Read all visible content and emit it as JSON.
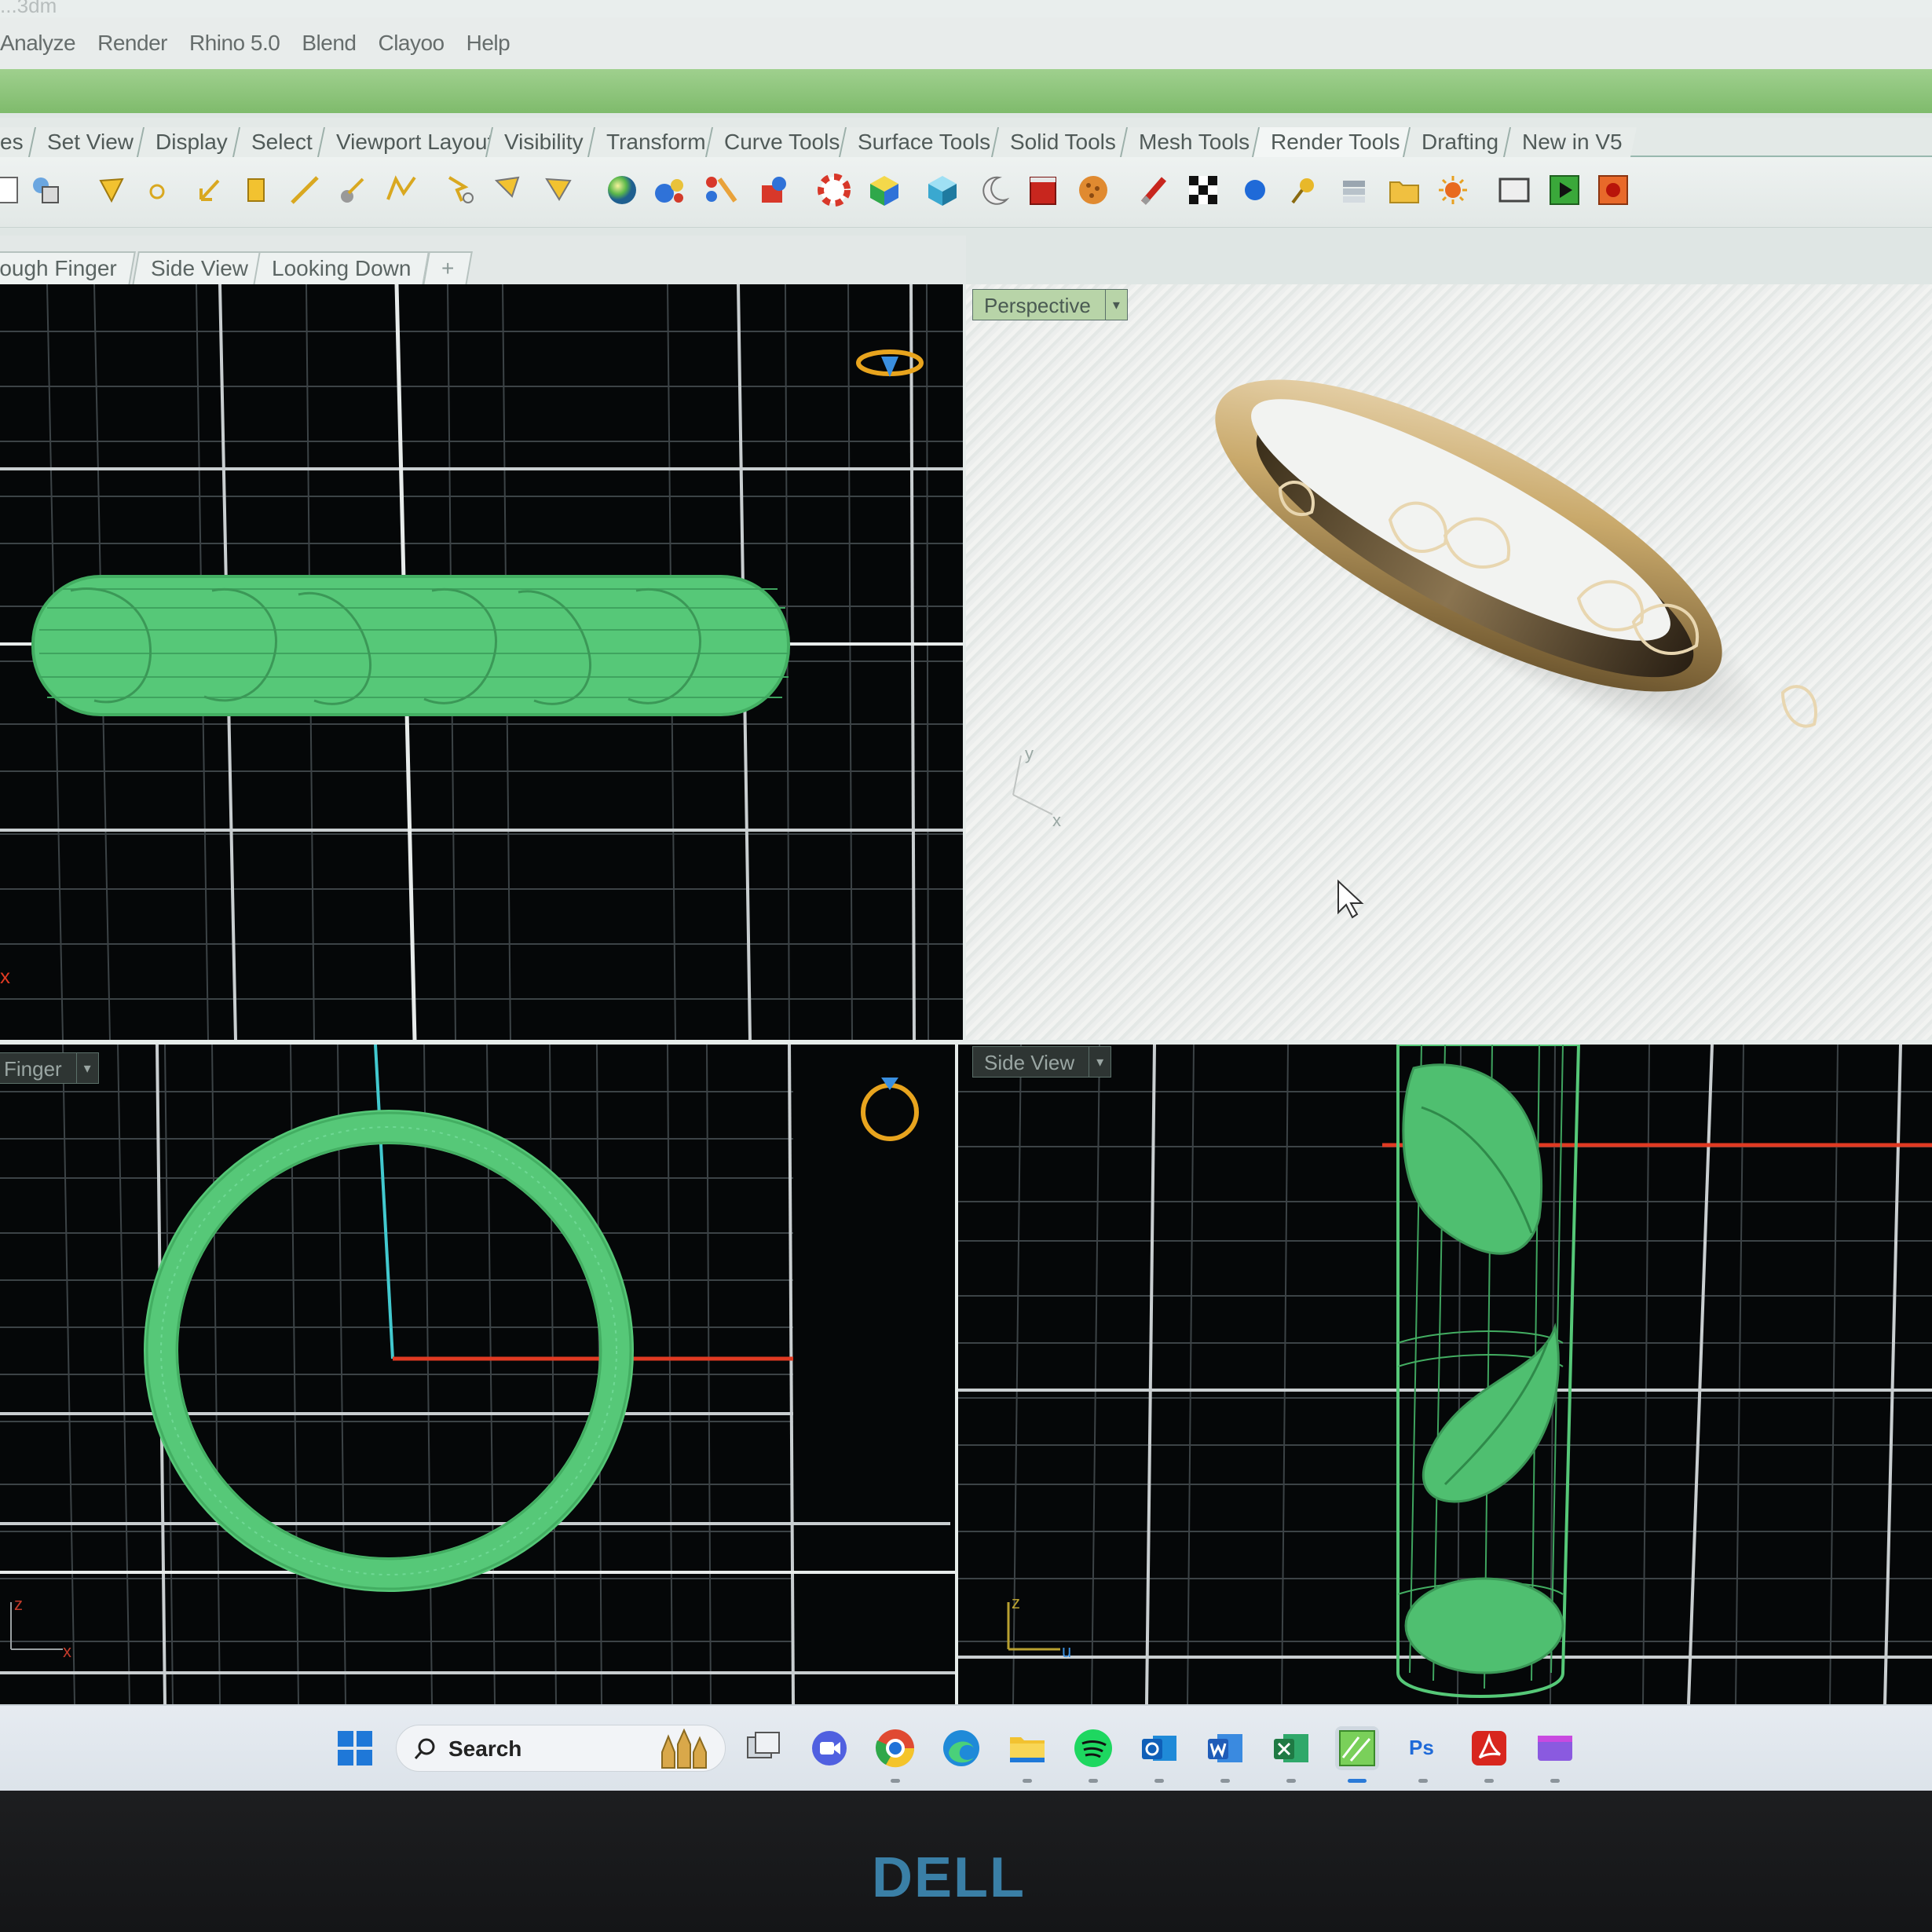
{
  "window": {
    "title_fragment": "...3dm"
  },
  "menubar": {
    "items": [
      "Analyze",
      "Render",
      "Rhino 5.0",
      "Blend",
      "Clayoo",
      "Help"
    ]
  },
  "toolbar_tabs": [
    "es",
    "Set View",
    "Display",
    "Select",
    "Viewport Layout",
    "Visibility",
    "Transform",
    "Curve Tools",
    "Surface Tools",
    "Solid Tools",
    "Mesh Tools",
    "Render Tools",
    "Drafting",
    "New in V5"
  ],
  "toolbar_active_tab": "Render Tools",
  "toolbar_icons": [
    "new-file-icon",
    "save-icon",
    "point-icon",
    "circle-icon",
    "arrow-icon",
    "rectangle-icon",
    "line-icon",
    "move-icon",
    "flag-icon",
    "select-icon",
    "select-points-icon",
    "select-lasso-icon",
    "sphere-icon",
    "render-spheres-icon",
    "material-icon",
    "material-library-icon",
    "lifebuoy-icon",
    "color-cube-icon",
    "cube-icon",
    "crescent-icon",
    "red-box-icon",
    "texture-ball-icon",
    "brush-icon",
    "checker-icon",
    "blue-sphere-icon",
    "key-icon",
    "layers-icon",
    "folder-icon",
    "light-icon",
    "viewport-icon",
    "play-icon",
    "record-icon"
  ],
  "viewport_tabs": [
    "rough Finger",
    "Side View",
    "Looking Down"
  ],
  "viewports": {
    "top_left": {
      "label": ""
    },
    "perspective": {
      "label": "Perspective"
    },
    "bottom_left": {
      "label": "Finger"
    },
    "side": {
      "label": "Side View"
    }
  },
  "axes": {
    "x": "x",
    "y": "y",
    "z": "z",
    "u": "u"
  },
  "taskbar": {
    "search_label": "Search",
    "apps": [
      "windows-start-icon",
      "search-icon",
      "widget-icon",
      "task-view-icon",
      "video-chat-icon",
      "chrome-icon",
      "edge-icon",
      "file-explorer-icon",
      "spotify-icon",
      "outlook-icon",
      "word-icon",
      "excel-icon",
      "rhino-icon",
      "photoshop-icon",
      "acrobat-icon",
      "media-icon"
    ],
    "ps_text": "Ps"
  },
  "bezel": {
    "brand": "DELL"
  },
  "colors": {
    "wire_green": "#5fcf7d",
    "grid_white": "#c9ced0",
    "axis_red": "#e03a22",
    "axis_cyan": "#42c9cf",
    "gold": "#c9a96b"
  }
}
